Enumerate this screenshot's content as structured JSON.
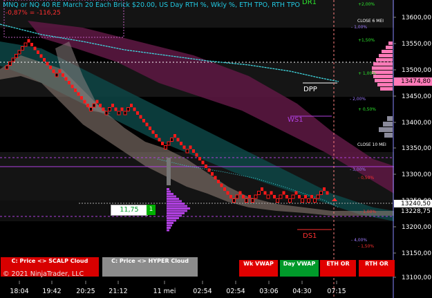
{
  "header": {
    "title": "MNQ or NQ 40 RE March 20 Each Brick $20.00, US Day RTH %, Wkly %, ETH TPO, RTH TPO",
    "change": "-0,87% = -116,25"
  },
  "copyright": "© 2021 NinjaTrader, LLC",
  "levels": {
    "dr1": "DR1",
    "dpp": "DPP",
    "ws1": "WS1",
    "ds1": "DS1",
    "close6": "CLOSE 6 MEI",
    "close10": "CLOSE 10 MEI"
  },
  "pct_labels": [
    {
      "text": "+2,00%",
      "color": "#2ee82e"
    },
    {
      "text": "- 1,00%",
      "color": "#a07cff"
    },
    {
      "text": "+1,50%",
      "color": "#2ee82e"
    },
    {
      "text": "+ 1,00%",
      "color": "#2ee82e"
    },
    {
      "text": "- 2,00%",
      "color": "#a07cff"
    },
    {
      "text": "+ 0,50%",
      "color": "#2ee82e"
    },
    {
      "text": "- 3,00%",
      "color": "#a07cff"
    },
    {
      "text": "- 0,50%",
      "color": "#ff3030"
    },
    {
      "text": "- 1,00%",
      "color": "#ff3030"
    },
    {
      "text": "- 4,00%",
      "color": "#a07cff"
    },
    {
      "text": "- 1,50%",
      "color": "#ff3030"
    }
  ],
  "y_axis": {
    "ticks": [
      "13600,00",
      "13550,00",
      "13500,00",
      "13450,00",
      "13400,00",
      "13350,00",
      "13300,00",
      "13250,00",
      "13200,00",
      "13150,00",
      "13100,00"
    ],
    "tags": [
      {
        "text": "13474,80",
        "bg": "#ff7ab8",
        "fg": "#000"
      },
      {
        "text": "13240,50",
        "bg": "#ffffff",
        "fg": "#000"
      },
      {
        "text": "13228,75",
        "bg": "#000000",
        "fg": "#fff"
      }
    ]
  },
  "x_axis": {
    "ticks": [
      "18:04",
      "19:42",
      "20:25",
      "21:12",
      "11 mei",
      "02:54",
      "02:54",
      "03:06",
      "04:30",
      "07:15"
    ]
  },
  "order": {
    "price": "11,75",
    "qty": "1"
  },
  "buttons": {
    "scalp": "C: Price <> SCALP Cloud",
    "hyper": "C: Price <> HYPER Cloud",
    "wk_vwap": "Wk VWAP",
    "day_vwap": "Day VWAP",
    "eth_or": "ETH OR",
    "rth_or": "RTH OR"
  },
  "colors": {
    "bg": "#000000",
    "brick_down": "#ff1a1a",
    "vwap": "#40d8e0",
    "profile_eth": "#ff7ab8",
    "profile_rth": "#b040e0"
  }
}
